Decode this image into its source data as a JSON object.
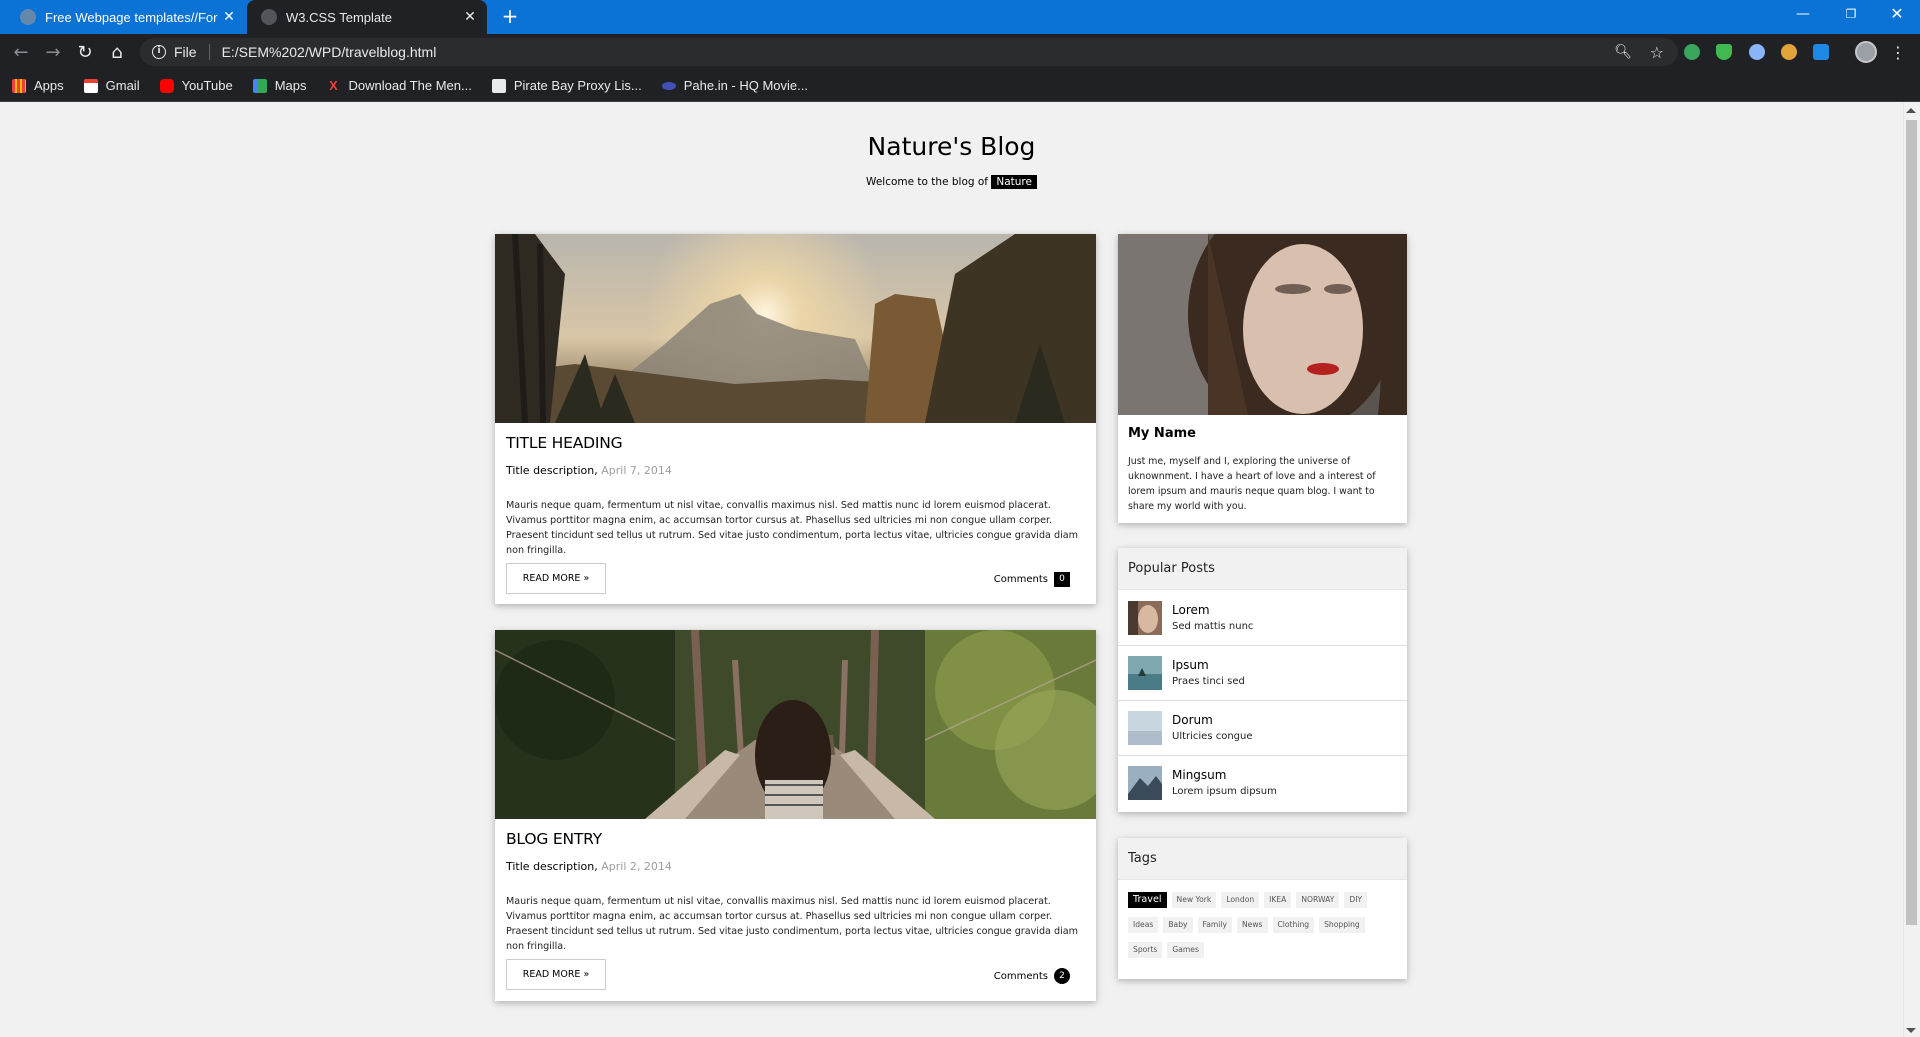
{
  "browser": {
    "tabs": [
      {
        "title": "Free Webpage templates//For ec",
        "close": "✕"
      },
      {
        "title": "W3.CSS Template",
        "close": "✕"
      }
    ],
    "new_tab": "+",
    "window_controls": {
      "minimize": "—",
      "maximize": "❐",
      "close": "✕"
    },
    "address": {
      "scheme": "File",
      "url": "E:/SEM%202/WPD/travelblog.html"
    },
    "bookmarks": [
      {
        "label": "Apps",
        "icon": "apps-grid-icon"
      },
      {
        "label": "Gmail",
        "icon": "gmail-icon"
      },
      {
        "label": "YouTube",
        "icon": "youtube-icon"
      },
      {
        "label": "Maps",
        "icon": "maps-icon"
      },
      {
        "label": "Download The Men...",
        "icon": "download-icon"
      },
      {
        "label": "Pirate Bay Proxy Lis...",
        "icon": "piratebay-icon"
      },
      {
        "label": "Pahe.in - HQ Movie...",
        "icon": "pahe-icon"
      }
    ]
  },
  "header": {
    "title": "Nature's Blog",
    "subtitle": "Welcome to the blog of",
    "tag": "Nature"
  },
  "posts": [
    {
      "heading": "TITLE HEADING",
      "description": "Title description,",
      "date": "April 7, 2014",
      "body": "Mauris neque quam, fermentum ut nisl vitae, convallis maximus nisl. Sed mattis nunc id lorem euismod placerat. Vivamus porttitor magna enim, ac accumsan tortor cursus at. Phasellus sed ultricies mi non congue ullam corper. Praesent tincidunt sed tellus ut rutrum. Sed vitae justo condimentum, porta lectus vitae, ultricies congue gravida diam non fringilla.",
      "read_more": "READ MORE »",
      "comments_label": "Comments",
      "comments_count": "0"
    },
    {
      "heading": "BLOG ENTRY",
      "description": "Title description,",
      "date": "April 2, 2014",
      "body": "Mauris neque quam, fermentum ut nisl vitae, convallis maximus nisl. Sed mattis nunc id lorem euismod placerat. Vivamus porttitor magna enim, ac accumsan tortor cursus at. Phasellus sed ultricies mi non congue ullam corper. Praesent tincidunt sed tellus ut rutrum. Sed vitae justo condimentum, porta lectus vitae, ultricies congue gravida diam non fringilla.",
      "read_more": "READ MORE »",
      "comments_label": "Comments",
      "comments_count": "2"
    }
  ],
  "profile": {
    "name": "My Name",
    "bio": "Just me, myself and I, exploring the universe of uknownment. I have a heart of love and a interest of lorem ipsum and mauris neque quam blog. I want to share my world with you."
  },
  "popular_posts": {
    "header": "Popular Posts",
    "items": [
      {
        "title": "Lorem",
        "subtitle": "Sed mattis nunc"
      },
      {
        "title": "Ipsum",
        "subtitle": "Praes tinci sed"
      },
      {
        "title": "Dorum",
        "subtitle": "Ultricies congue"
      },
      {
        "title": "Mingsum",
        "subtitle": "Lorem ipsum dipsum"
      }
    ]
  },
  "tags": {
    "header": "Tags",
    "items": [
      "Travel",
      "New York",
      "London",
      "IKEA",
      "NORWAY",
      "DIY",
      "Ideas",
      "Baby",
      "Family",
      "News",
      "Clothing",
      "Shopping",
      "Sports",
      "Games"
    ],
    "active": "Travel"
  }
}
